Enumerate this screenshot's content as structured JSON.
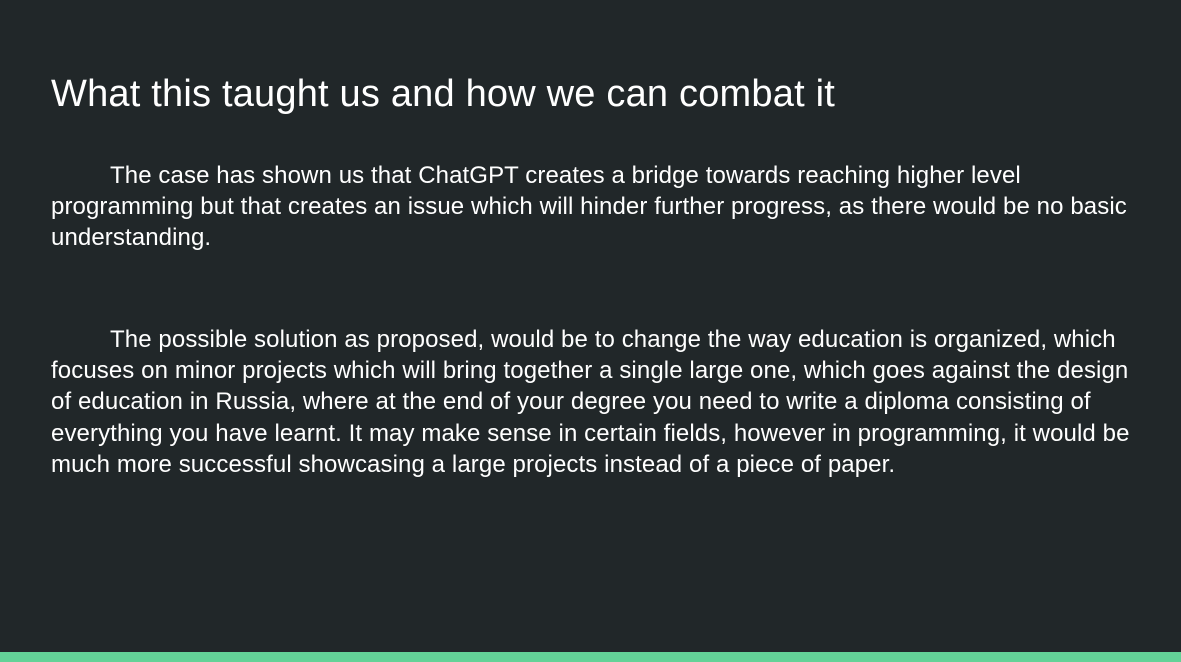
{
  "slide": {
    "title": "What this taught us and how we can combat it",
    "paragraphs": [
      "The case has shown us that ChatGPT creates a bridge towards reaching higher level programming but that creates an issue which will hinder further progress, as there would be no basic understanding.",
      "The possible solution as proposed, would be to change the way education is organized, which focuses on minor projects which will bring together a single large one, which goes against the design of education in Russia, where at the end of your degree you need to write a diploma consisting of everything you have learnt. It may make sense in certain fields, however in programming, it would be much more successful showcasing a large projects instead of a piece of paper."
    ]
  },
  "colors": {
    "background": "#212729",
    "text": "#ffffff",
    "accent": "#63d297"
  }
}
